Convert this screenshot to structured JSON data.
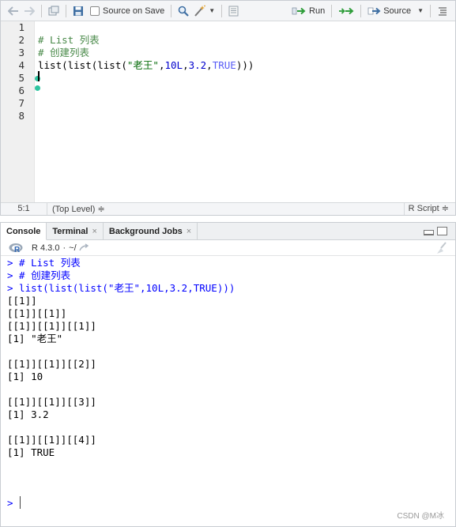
{
  "editor": {
    "toolbar": {
      "source_on_save_label": "Source on Save",
      "run_label": "Run",
      "source_label": "Source"
    },
    "line_numbers": [
      "1",
      "2",
      "3",
      "4",
      "5",
      "6",
      "7",
      "8"
    ],
    "code": {
      "line2": "# List 列表",
      "line3": "# 创建列表",
      "line4_prefix": "list(list(list(",
      "line4_string": "\"老王\"",
      "line4_comma1": ",",
      "line4_num1": "10L",
      "line4_comma2": ",",
      "line4_num2": "3.2",
      "line4_comma3": ",",
      "line4_true": "TRUE",
      "line4_suffix": ")))"
    },
    "status": {
      "position": "5:1",
      "scope": "(Top Level) ≑",
      "file_type": "R Script ≑"
    }
  },
  "console": {
    "tabs": [
      {
        "label": "Console",
        "active": true
      },
      {
        "label": "Terminal",
        "close": "×"
      },
      {
        "label": "Background Jobs",
        "close": "×"
      }
    ],
    "r_version": "R 4.3.0",
    "working_dir": "~/",
    "lines": [
      "> # List 列表",
      "> # 创建列表",
      "> list(list(list(\"老王\",10L,3.2,TRUE)))",
      "[[1]]",
      "[[1]][[1]]",
      "[[1]][[1]][[1]]",
      "[1] \"老王\"",
      "",
      "[[1]][[1]][[2]]",
      "[1] 10",
      "",
      "[[1]][[1]][[3]]",
      "[1] 3.2",
      "",
      "[[1]][[1]][[4]]",
      "[1] TRUE"
    ],
    "prompt": ">",
    "watermark": "CSDN @M冰"
  },
  "colors": {
    "comment": "#4a8a4a",
    "string": "#036a07",
    "number": "#0000cd",
    "keyword": "#585cf6",
    "prompt": "#0000ff",
    "run_arrow": "#2e9d3a"
  }
}
